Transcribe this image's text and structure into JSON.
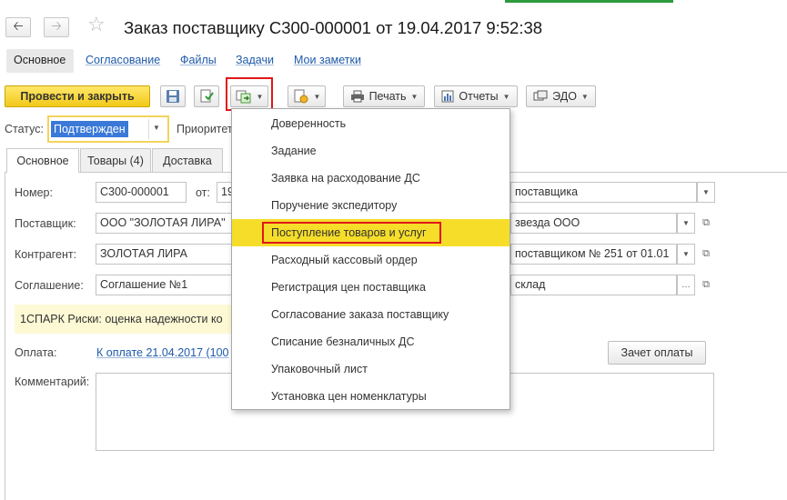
{
  "window": {
    "title": "Заказ поставщику С300-000001 от 19.04.2017 9:52:38",
    "back_icon": "arrow-left-icon",
    "forward_icon": "arrow-right-icon",
    "favorite_icon": "star-icon"
  },
  "sections": [
    {
      "label": "Основное",
      "active": true
    },
    {
      "label": "Согласование"
    },
    {
      "label": "Файлы"
    },
    {
      "label": "Задачи"
    },
    {
      "label": "Мои заметки"
    }
  ],
  "toolbar": {
    "post_close_label": "Провести и закрыть",
    "save_icon": "save-icon",
    "post_icon": "post-document-icon",
    "create_based_icon": "create-based-on-icon",
    "copy_icon": "related-documents-icon",
    "print_label": "Печать",
    "reports_label": "Отчеты",
    "edo_label": "ЭДО"
  },
  "status": {
    "label": "Статус:",
    "value": "Подтвержден",
    "priority_label": "Приоритет"
  },
  "form_tabs": [
    {
      "label": "Основное",
      "active": true
    },
    {
      "label": "Товары (4)"
    },
    {
      "label": "Доставка"
    }
  ],
  "fields": {
    "number_label": "Номер:",
    "number_value": "С300-000001",
    "date_label": "от:",
    "date_value": "19",
    "operation_value": "поставщика",
    "supplier_label": "Поставщик:",
    "supplier_value": "ООО \"ЗОЛОТАЯ ЛИРА\"",
    "organization_value": "звезда ООО",
    "counterparty_label": "Контрагент:",
    "counterparty_value": "ЗОЛОТАЯ ЛИРА",
    "contract_value": "поставщиком № 251 от 01.01",
    "agreement_label": "Соглашение:",
    "agreement_value": "Соглашение №1",
    "warehouse_value": "склад",
    "spark_text": "1СПАРК Риски: оценка надежности ко",
    "payment_label": "Оплата:",
    "payment_link": "К оплате 21.04.2017 (100",
    "offset_button": "Зачет оплаты",
    "comment_label": "Комментарий:",
    "comment_value": ""
  },
  "create_menu": {
    "items": [
      "Доверенность",
      "Задание",
      "Заявка на расходование ДС",
      "Поручение экспедитору",
      "Поступление товаров и услуг",
      "Расходный кассовый ордер",
      "Регистрация цен поставщика",
      "Согласование заказа поставщику",
      "Списание безналичных ДС",
      "Упаковочный лист",
      "Установка цен номенклатуры"
    ],
    "highlighted": "Поступление товаров и услуг",
    "highlight_color": "#f5dd2a",
    "annotation_color": "#e01818"
  }
}
